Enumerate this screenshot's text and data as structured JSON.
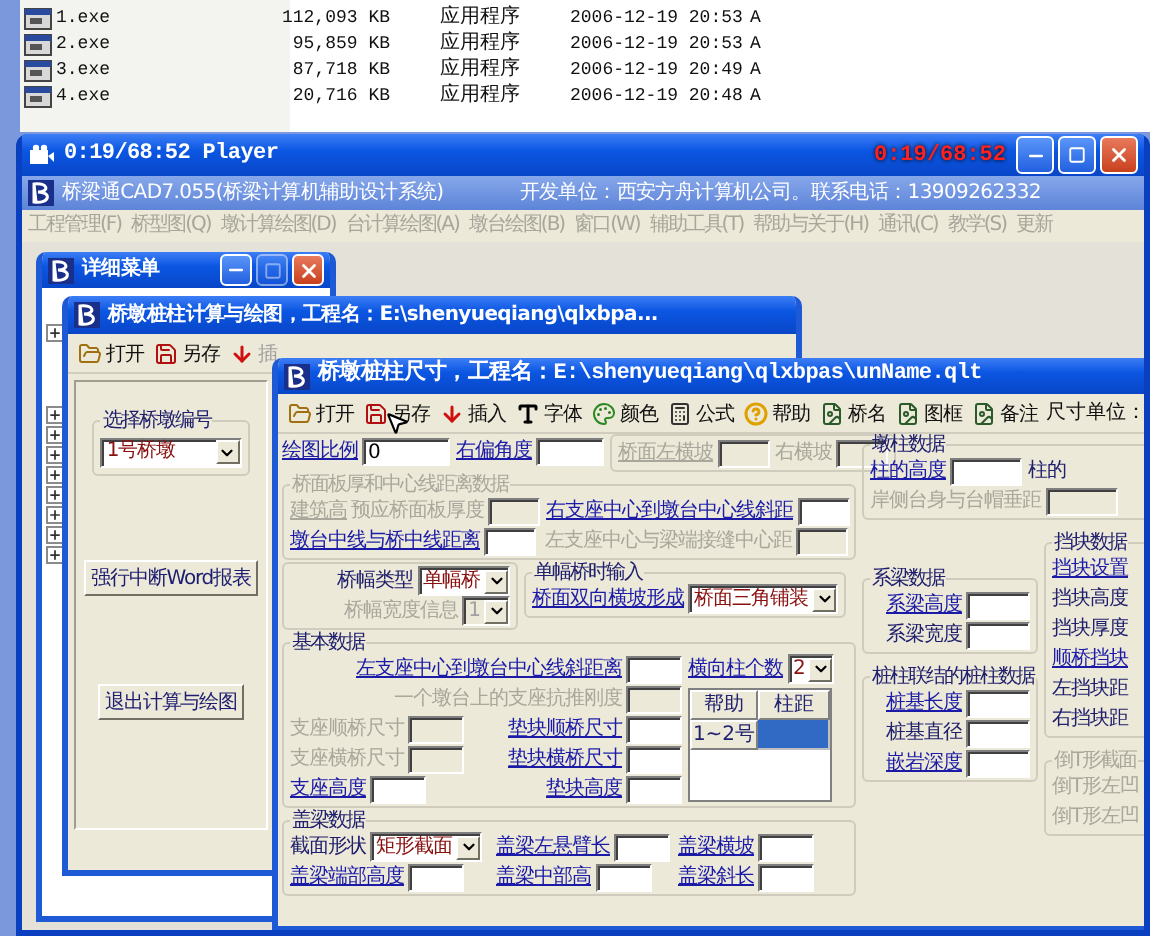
{
  "file_list": [
    {
      "name": "1.exe",
      "size": "112,093 KB",
      "type": "应用程序",
      "modified": "2006-12-19 20:53",
      "attributes": "A"
    },
    {
      "name": "2.exe",
      "size": "95,859 KB",
      "type": "应用程序",
      "modified": "2006-12-19 20:53",
      "attributes": "A"
    },
    {
      "name": "3.exe",
      "size": "87,718 KB",
      "type": "应用程序",
      "modified": "2006-12-19 20:49",
      "attributes": "A"
    },
    {
      "name": "4.exe",
      "size": "20,716 KB",
      "type": "应用程序",
      "modified": "2006-12-19 20:48",
      "attributes": "A"
    }
  ],
  "player": {
    "title": "0:19/68:52 Player",
    "time_overlay": "0:19/68:52"
  },
  "app": {
    "title": "桥梁通CAD7.055(桥梁计算机辅助设计系统)",
    "developer": "开发单位：西安方舟计算机公司。联系电话：13909262332"
  },
  "menu": [
    {
      "label": "工程管理(F)",
      "disabled": true
    },
    {
      "label": "桥型图(Q)",
      "disabled": true
    },
    {
      "label": "墩计算绘图(D)",
      "disabled": true
    },
    {
      "label": "台计算绘图(A)",
      "disabled": true
    },
    {
      "label": "墩台绘图(B)",
      "disabled": true
    },
    {
      "label": "窗口(W)",
      "disabled": true
    },
    {
      "label": "辅助工具(T)",
      "disabled": true
    },
    {
      "label": "帮助与关于(H)",
      "disabled": true
    },
    {
      "label": "通讯(C)",
      "disabled": true
    },
    {
      "label": "教学(S)",
      "disabled": true
    },
    {
      "label": "更新",
      "disabled": true
    }
  ],
  "menu_window": {
    "title": "详细菜单",
    "tree": [
      {
        "expanded": false
      },
      {
        "expanded": false
      },
      {
        "expanded": false
      },
      {
        "expanded": false
      },
      {
        "expanded": false
      },
      {
        "expanded": false
      },
      {
        "expanded": false
      },
      {
        "expanded": false
      },
      {
        "expanded": false
      }
    ]
  },
  "calc_window": {
    "title": "桥墩桩柱计算与绘图，工程名：E:\\shenyueqiang\\qlxbpa...",
    "toolbar": [
      {
        "label": "打开",
        "disabled": false
      },
      {
        "label": "另存",
        "disabled": false
      },
      {
        "label": "插",
        "disabled": true
      }
    ],
    "pier_group": {
      "legend": "选择桥墩编号",
      "value": "1号桥墩"
    },
    "buttons": [
      "强行中断Word报表",
      "退出计算与绘图"
    ]
  },
  "dialog": {
    "title": "桥墩桩柱尺寸，工程名：E:\\shenyueqiang\\qlxbpas\\unName.qlt",
    "toolbar": [
      "打开",
      "另存",
      "插入",
      "字体",
      "颜色",
      "公式",
      "帮助",
      "桥名",
      "图框",
      "备注"
    ],
    "unit_label": "尺寸单位：",
    "scale_row": [
      {
        "label": "绘图比例",
        "link": true,
        "disabled": false,
        "kind": "input",
        "value": "0"
      },
      {
        "label": "右偏角度",
        "link": true,
        "disabled": false,
        "kind": "input"
      }
    ],
    "cross_slope": [
      {
        "label": "桥面左横坡",
        "link": true,
        "disabled": true,
        "kind": "input"
      },
      {
        "label": "右横坡",
        "link": false,
        "disabled": true,
        "kind": "input"
      }
    ],
    "deck": {
      "legend": "桥面板厚和中心线距离数据",
      "disabled": true,
      "prefix": {
        "label": "建筑高",
        "link": true,
        "disabled": true,
        "kind": "label"
      },
      "rows": [
        [
          {
            "label": "预应桥面板厚度",
            "link": false,
            "disabled": true,
            "kind": "input"
          },
          {
            "label": "右支座中心到墩台中心线斜距",
            "link": true,
            "disabled": false,
            "kind": "input"
          }
        ],
        [
          {
            "label": "墩台中线与桥中线距离",
            "link": true,
            "disabled": false,
            "kind": "input"
          },
          {
            "label": "左支座中心与梁端接缝中心距",
            "link": false,
            "disabled": true,
            "kind": "input"
          }
        ]
      ]
    },
    "width_type": {
      "rows": [
        [
          {
            "label": "桥幅类型",
            "link": false,
            "disabled": false,
            "kind": "select",
            "value": "单幅桥"
          }
        ],
        [
          {
            "label": "桥幅宽度信息",
            "link": false,
            "disabled": true,
            "kind": "select",
            "value": "1"
          }
        ]
      ]
    },
    "single_width": {
      "legend": "单幅桥时输入",
      "disabled": false,
      "rows": [
        [
          {
            "label": "桥面双向横坡形成",
            "link": true,
            "disabled": false,
            "kind": "select",
            "value": "桥面三角铺装"
          }
        ]
      ]
    },
    "basic": {
      "legend": "基本数据",
      "disabled": false,
      "rows": [
        [
          {
            "label": "左支座中心到墩台中心线斜距离",
            "link": true,
            "disabled": false,
            "kind": "input"
          }
        ],
        [
          {
            "label": "一个墩台上的支座抗推刚度",
            "link": false,
            "disabled": true,
            "kind": "input"
          }
        ],
        [
          {
            "label": "支座顺桥尺寸",
            "link": false,
            "disabled": true,
            "kind": "input"
          },
          {
            "label": "垫块顺桥尺寸",
            "link": true,
            "disabled": false,
            "kind": "input"
          }
        ],
        [
          {
            "label": "支座横桥尺寸",
            "link": false,
            "disabled": true,
            "kind": "input"
          },
          {
            "label": "垫块横桥尺寸",
            "link": true,
            "disabled": false,
            "kind": "input"
          }
        ],
        [
          {
            "label": "支座高度",
            "link": true,
            "disabled": false,
            "kind": "input"
          },
          {
            "label": "垫块高度",
            "link": true,
            "disabled": false,
            "kind": "input"
          }
        ]
      ],
      "column_count": {
        "label": "横向柱个数",
        "link": true,
        "disabled": false,
        "kind": "select",
        "value": "2"
      },
      "spacing_table": {
        "columns": [
          "帮助",
          "柱距"
        ],
        "rows": [
          {
            "label": "1~2号",
            "selected": true
          }
        ]
      }
    },
    "cap_beam": {
      "legend": "盖梁数据",
      "disabled": false,
      "rows": [
        [
          {
            "label": "截面形状",
            "link": false,
            "disabled": false,
            "kind": "select",
            "value": "矩形截面"
          },
          {
            "label": "盖梁左悬臂长",
            "link": true,
            "disabled": false,
            "kind": "input"
          },
          {
            "label": "盖梁横坡",
            "link": true,
            "disabled": false,
            "kind": "input"
          }
        ],
        [
          {
            "label": "盖梁端部高度",
            "link": true,
            "disabled": false,
            "kind": "input"
          },
          {
            "label": "盖梁中部高",
            "link": true,
            "disabled": false,
            "kind": "input"
          },
          {
            "label": "盖梁斜长",
            "link": true,
            "disabled": false,
            "kind": "input"
          }
        ]
      ]
    },
    "pier_column": {
      "legend": "墩柱数据",
      "disabled": false,
      "rows": [
        [
          {
            "label": "柱的高度",
            "link": true,
            "disabled": false,
            "kind": "input"
          },
          {
            "label": "柱的",
            "link": false,
            "disabled": false,
            "kind": "label"
          }
        ],
        [
          {
            "label": "岸侧台身与台帽垂距",
            "link": false,
            "disabled": true,
            "kind": "input"
          }
        ]
      ]
    },
    "tie_beam": {
      "legend": "系梁数据",
      "disabled": false,
      "rows": [
        [
          {
            "label": "系梁高度",
            "link": true,
            "disabled": false,
            "kind": "input"
          }
        ],
        [
          {
            "label": "系梁宽度",
            "link": false,
            "disabled": false,
            "kind": "input"
          }
        ]
      ]
    },
    "pile": {
      "legend": "桩柱联结的桩柱数据",
      "disabled": false,
      "rows": [
        [
          {
            "label": "桩基长度",
            "link": true,
            "disabled": false,
            "kind": "input"
          }
        ],
        [
          {
            "label": "桩基直径",
            "link": false,
            "disabled": false,
            "kind": "input"
          }
        ],
        [
          {
            "label": "嵌岩深度",
            "link": true,
            "disabled": false,
            "kind": "input"
          }
        ]
      ]
    },
    "block": {
      "legend": "挡块数据",
      "disabled": false,
      "rows": [
        [
          {
            "label": "挡块设置",
            "link": true,
            "disabled": false,
            "kind": "label"
          }
        ],
        [
          {
            "label": "挡块高度",
            "link": false,
            "disabled": false,
            "kind": "label"
          }
        ],
        [
          {
            "label": "挡块厚度",
            "link": false,
            "disabled": false,
            "kind": "label"
          }
        ],
        [
          {
            "label": "顺桥挡块",
            "link": true,
            "disabled": false,
            "kind": "label"
          }
        ],
        [
          {
            "label": "左挡块距",
            "link": false,
            "disabled": false,
            "kind": "label"
          }
        ],
        [
          {
            "label": "右挡块距",
            "link": false,
            "disabled": false,
            "kind": "label"
          }
        ]
      ]
    },
    "inverted_t": {
      "legend": "倒T形截面",
      "disabled": true,
      "rows": [
        [
          {
            "label": "倒T形左凹",
            "link": false,
            "disabled": true,
            "kind": "label"
          }
        ],
        [
          {
            "label": "倒T形左凹",
            "link": false,
            "disabled": true,
            "kind": "label"
          }
        ]
      ]
    }
  }
}
